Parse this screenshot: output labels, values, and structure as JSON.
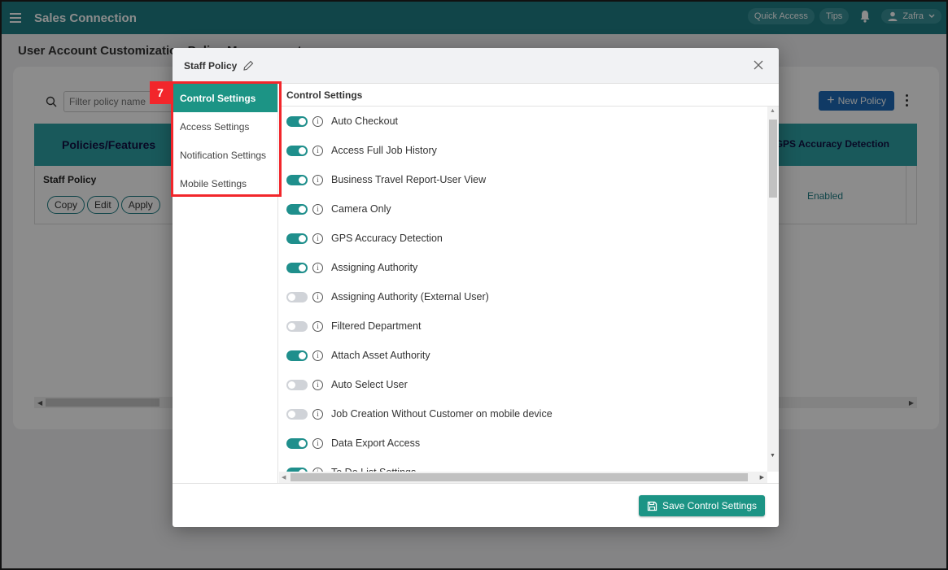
{
  "app": {
    "title": "Sales Connection",
    "quick_access": "Quick Access",
    "tips": "Tips",
    "user_name": "Zafra"
  },
  "page": {
    "title": "User Account Customization Policy Management",
    "filter_placeholder": "Filter policy name",
    "new_policy_label": "New Policy",
    "table": {
      "headers": [
        "Policies/Features",
        "GPS Accuracy Detection"
      ],
      "rows": [
        {
          "name": "Staff Policy",
          "actions": [
            "Copy",
            "Edit",
            "Apply"
          ],
          "gps_accuracy_detection": "Enabled"
        }
      ]
    }
  },
  "modal": {
    "title": "Staff Policy",
    "step_badge": "7",
    "nav": [
      {
        "label": "Control Settings",
        "active": true
      },
      {
        "label": "Access Settings",
        "active": false
      },
      {
        "label": "Notification Settings",
        "active": false
      },
      {
        "label": "Mobile Settings",
        "active": false
      }
    ],
    "section_title": "Control Settings",
    "settings": [
      {
        "label": "Auto Checkout",
        "enabled": true
      },
      {
        "label": "Access Full Job History",
        "enabled": true
      },
      {
        "label": "Business Travel Report-User View",
        "enabled": true
      },
      {
        "label": "Camera Only",
        "enabled": true
      },
      {
        "label": "GPS Accuracy Detection",
        "enabled": true
      },
      {
        "label": "Assigning Authority",
        "enabled": true
      },
      {
        "label": "Assigning Authority (External User)",
        "enabled": false
      },
      {
        "label": "Filtered Department",
        "enabled": false
      },
      {
        "label": "Attach Asset Authority",
        "enabled": true
      },
      {
        "label": "Auto Select User",
        "enabled": false
      },
      {
        "label": "Job Creation Without Customer on mobile device",
        "enabled": false
      },
      {
        "label": "Data Export Access",
        "enabled": true
      },
      {
        "label": "To Do List Settings",
        "enabled": true
      }
    ],
    "save_label": "Save Control Settings"
  },
  "colors": {
    "topbar": "#1f7f86",
    "accent": "#1c9485",
    "highlight": "#f2262b",
    "new_policy": "#1e6bb8"
  }
}
